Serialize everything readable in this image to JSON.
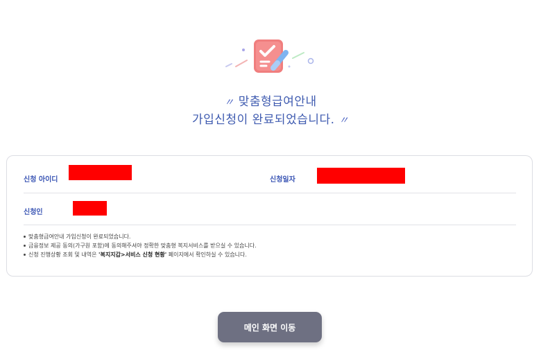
{
  "completion": {
    "icon": "checklist-pencil-icon",
    "title_line1": "맞춤형급여안내",
    "title_line2": "가입신청이 완료되었습니다.",
    "open_quote": "〃",
    "close_quote": "〃"
  },
  "details": {
    "applicant_id_label": "신청 아이디",
    "application_date_label": "신청일자",
    "applicant_label": "신청인",
    "redaction_color": "#ff0000"
  },
  "notes": {
    "note1": "맞춤형급여안내 가입신청이 완료되었습니다.",
    "note2": "금융정보 제공 동의(가구원 포함)에 동의해주셔야 정확한 맞춤형 복지서비스를 받으실 수 있습니다.",
    "note3_prefix": "신청 진행상황 조회 및 내역은 ",
    "note3_bold": "'복지지갑>서비스 신청 현황'",
    "note3_suffix": " 페이지에서 확인하실 수 있습니다."
  },
  "actions": {
    "main_button_label": "메인 화면 이동"
  },
  "colors": {
    "accent": "#3f5bb0",
    "button": "#6e7082"
  }
}
